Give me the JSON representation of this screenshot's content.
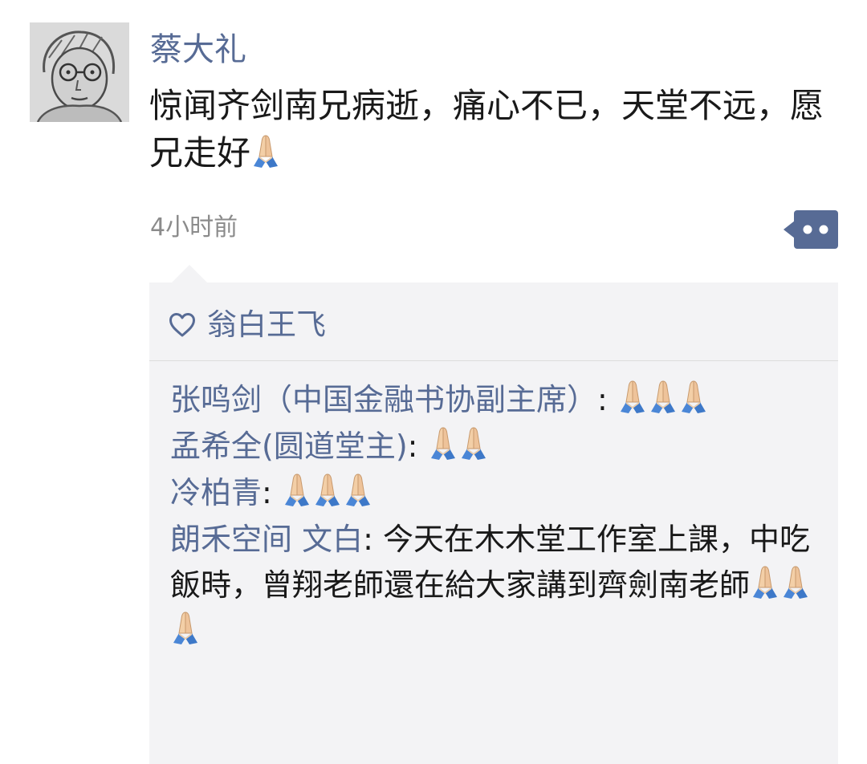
{
  "post": {
    "author": "蔡大礼",
    "text": "惊闻齐剑南兄病逝，痛心不已，天堂不远，愿兄走好",
    "text_emoji_count": 1,
    "timestamp": "4小时前"
  },
  "likes": {
    "icon": "heart-outline-icon",
    "names": [
      "翁白王飞"
    ]
  },
  "comments": [
    {
      "name": "张鸣剑（中国金融书协副主席）",
      "sep": ": ",
      "text": "",
      "emoji_count": 3
    },
    {
      "name": "孟希全(圆道堂主)",
      "sep": ": ",
      "text": "",
      "emoji_count": 2
    },
    {
      "name": "冷柏青",
      "sep": ": ",
      "text": "",
      "emoji_count": 3
    },
    {
      "name": "朗禾空间 文白",
      "sep": ": ",
      "text": "今天在木木堂工作室上課，中吃飯時，曾翔老師還在給大家講到齊劍南老師",
      "emoji_count": 3
    }
  ],
  "colors": {
    "link": "#576b95",
    "text": "#191919",
    "meta": "#8b8b8b",
    "panel": "#f3f3f5",
    "more_button": "#576b95"
  },
  "icons": {
    "emoji": "folded-hands-icon",
    "more": "more-dots-icon"
  }
}
